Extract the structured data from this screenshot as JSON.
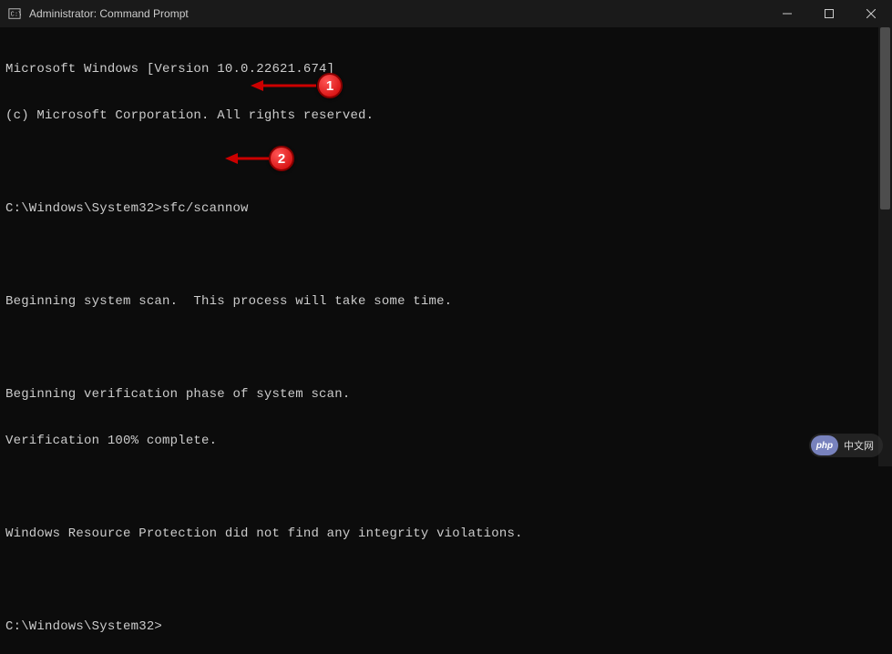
{
  "titlebar": {
    "title": "Administrator: Command Prompt"
  },
  "terminal": {
    "lines": [
      "Microsoft Windows [Version 10.0.22621.674]",
      "(c) Microsoft Corporation. All rights reserved.",
      "",
      "C:\\Windows\\System32>sfc/scannow",
      "",
      "Beginning system scan.  This process will take some time.",
      "",
      "Beginning verification phase of system scan.",
      "Verification 100% complete.",
      "",
      "Windows Resource Protection did not find any integrity violations.",
      "",
      "C:\\Windows\\System32>"
    ]
  },
  "annotations": {
    "badge1": "1",
    "badge2": "2"
  },
  "watermark": {
    "logo": "php",
    "text": "中文网"
  }
}
